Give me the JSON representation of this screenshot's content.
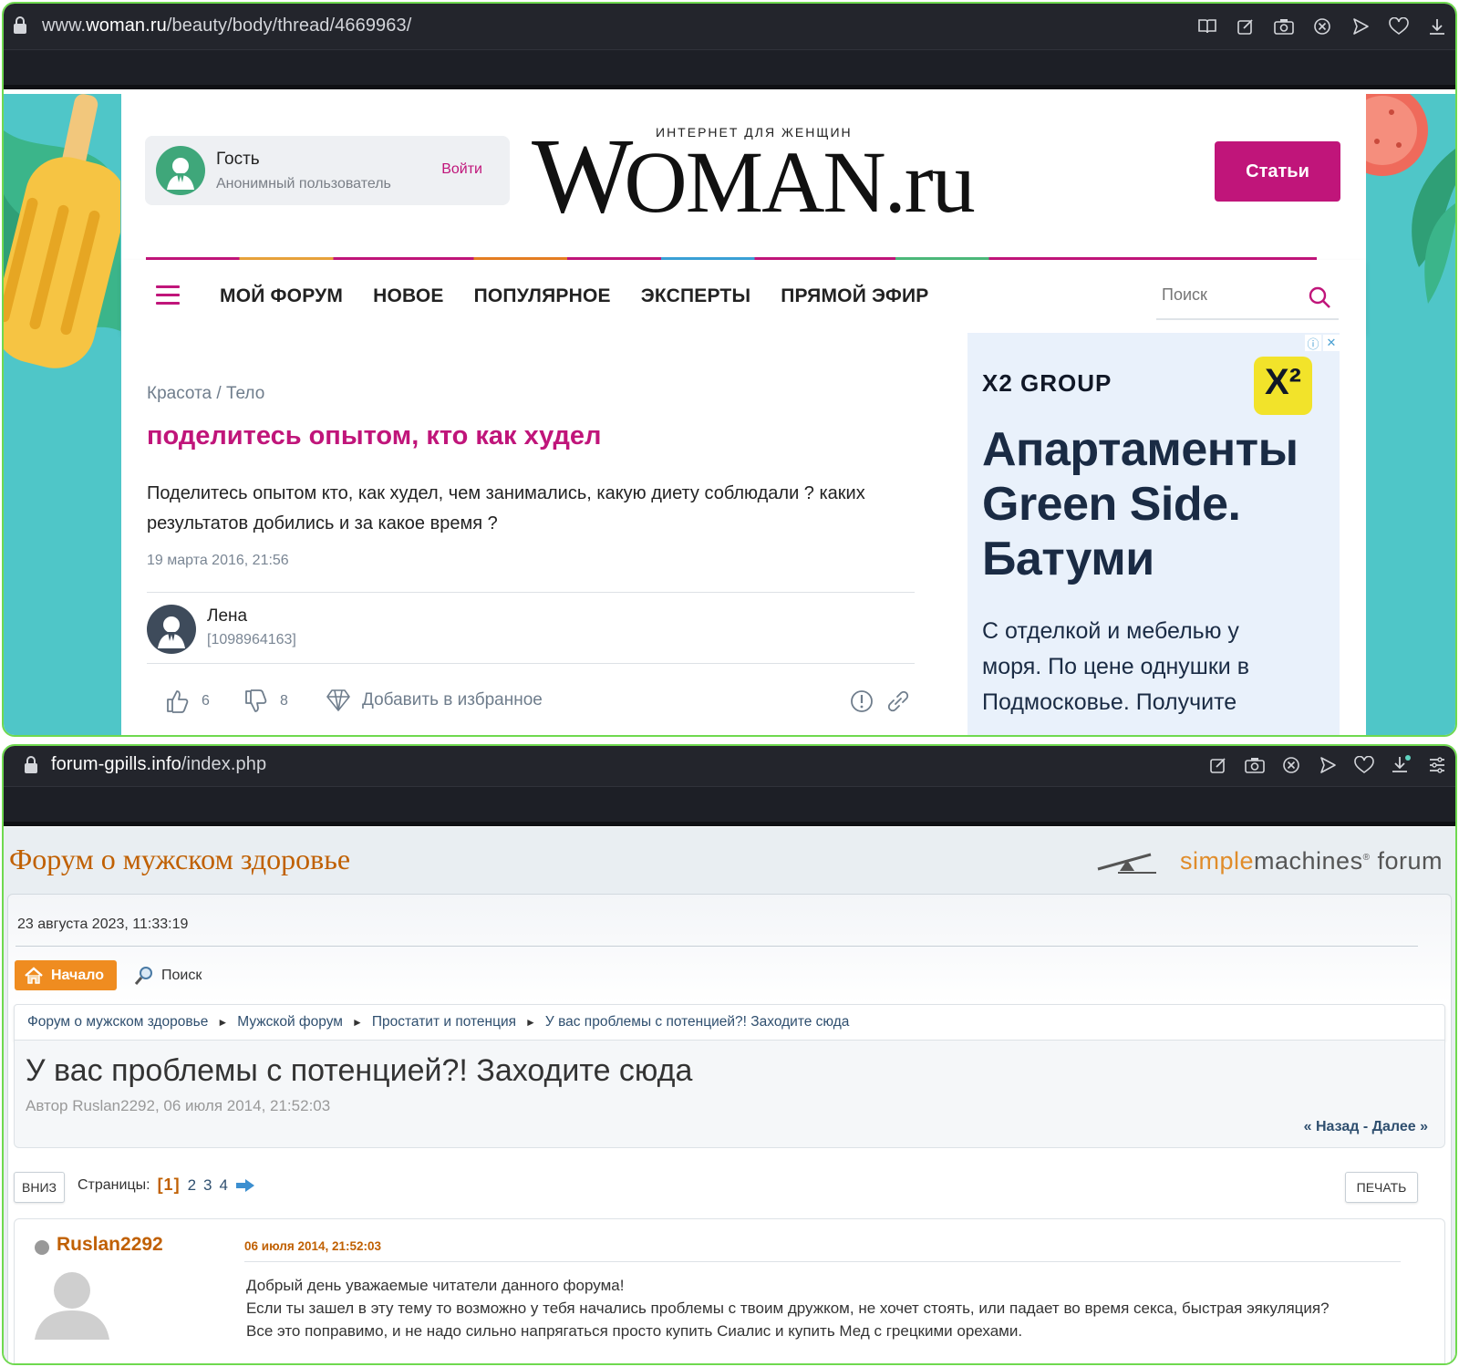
{
  "top_window": {
    "url_prefix": "www.",
    "url_domain": "woman.ru",
    "url_path": "/beauty/body/thread/4669963/",
    "toolbar_icons": [
      "reader-icon",
      "edit-icon",
      "camera-icon",
      "adblock-icon",
      "send-icon",
      "heart-icon",
      "download-icon"
    ],
    "guest": {
      "name": "Гость",
      "subtitle": "Анонимный пользователь",
      "login": "Войти"
    },
    "logo": {
      "tagline": "ИНТЕРНЕТ ДЛЯ ЖЕНЩИН",
      "first": "W",
      "rest": "OMAN.ru"
    },
    "articles_button": "Статьи",
    "nav": [
      "МОЙ ФОРУМ",
      "НОВОЕ",
      "ПОПУЛЯРНОЕ",
      "ЭКСПЕРТЫ",
      "ПРЯМОЙ ЭФИР"
    ],
    "search_placeholder": "Поиск",
    "breadcrumb": "Красота / Тело",
    "topic_title": "поделитесь опытом, кто как худел",
    "topic_body": "Поделитесь опытом кто, как худел, чем занимались, какую диету соблюдали ? каких результатов добились и за какое время ?",
    "topic_date": "19 марта 2016, 21:56",
    "author": {
      "name": "Лена",
      "id": "[1098964163]"
    },
    "likes": "6",
    "dislikes": "8",
    "favorite": "Добавить в избранное",
    "ad": {
      "brand": "X2 GROUP",
      "logo_text": "X²",
      "headline": "Апартаменты Green Side. Батуми",
      "text": "С отделкой и мебелью у моря. По цене однушки в Подмосковье. Получите"
    },
    "colors": {
      "accent": "#c0157a",
      "teal": "#4fc6c8",
      "frame": "#6fd94f"
    }
  },
  "bottom_window": {
    "url_domain": "forum-gpills.info",
    "url_path": "/index.php",
    "toolbar_icons": [
      "edit-icon",
      "camera-icon",
      "adblock-icon",
      "send-icon",
      "heart-icon",
      "download-icon",
      "menu-icon"
    ],
    "forum_title": "Форум о мужском здоровье",
    "smf_logo": {
      "part1": "simple",
      "part2": "machines",
      "part3": "forum"
    },
    "date": "23 августа 2023, 11:33:19",
    "home_button": "Начало",
    "search_link": "Поиск",
    "linktree": [
      "Форум о мужском здоровье",
      "Мужской форум",
      "Простатит и потенция",
      "У вас проблемы с потенцией?! Заходите сюда"
    ],
    "topic": "У вас проблемы с потенцией?! Заходите сюда",
    "byline": "Автор Ruslan2292, 06 июля 2014, 21:52:03",
    "prevnext": "« Назад - Далее »",
    "down_button": "ВНИЗ",
    "pages_label": "Страницы:",
    "current_page": "[1]",
    "pages": [
      "2",
      "3",
      "4"
    ],
    "print_button": "ПЕЧАТЬ",
    "post": {
      "author": "Ruslan2292",
      "date": "06 июля 2014, 21:52:03",
      "lines": [
        "Добрый день уважаемые читатели данного форума!",
        "Если ты зашел в эту тему то возможно у тебя начались проблемы с твоим дружком, не хочет стоять, или падает во время секса, быстрая эякуляция?",
        "Все это поправимо, и не надо сильно напрягаться просто купить Сиалис и купить Мед с грецкими орехами."
      ]
    },
    "colors": {
      "title": "#c06002",
      "home": "#ef8c20",
      "link": "#2f4f6f"
    }
  }
}
